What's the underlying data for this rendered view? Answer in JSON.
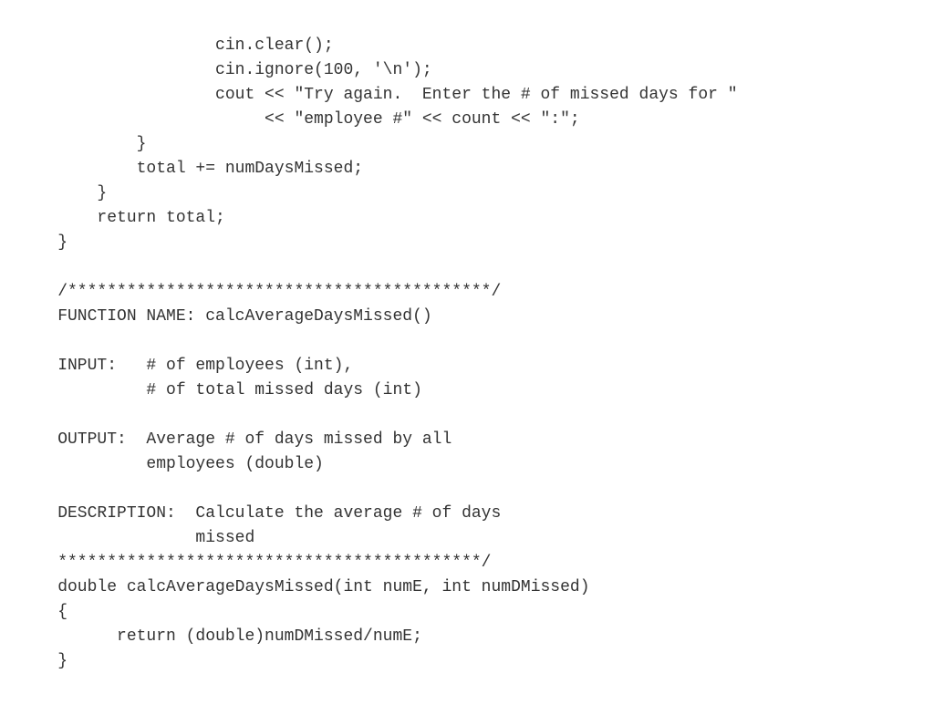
{
  "code": {
    "lines": [
      "                    cin.clear();",
      "                    cin.ignore(100, '\\n');",
      "                    cout << \"Try again.  Enter the # of missed days for \"",
      "                         << \"employee #\" << count << \":\";",
      "            }",
      "            total += numDaysMissed;",
      "        }",
      "        return total;",
      "    }",
      "",
      "    /*******************************************/",
      "    FUNCTION NAME: calcAverageDaysMissed()",
      "",
      "    INPUT:   # of employees (int),",
      "             # of total missed days (int)",
      "",
      "    OUTPUT:  Average # of days missed by all",
      "             employees (double)",
      "",
      "    DESCRIPTION:  Calculate the average # of days",
      "                  missed",
      "    *******************************************/",
      "    double calcAverageDaysMissed(int numE, int numDMissed)",
      "    {",
      "          return (double)numDMissed/numE;",
      "    }"
    ]
  }
}
